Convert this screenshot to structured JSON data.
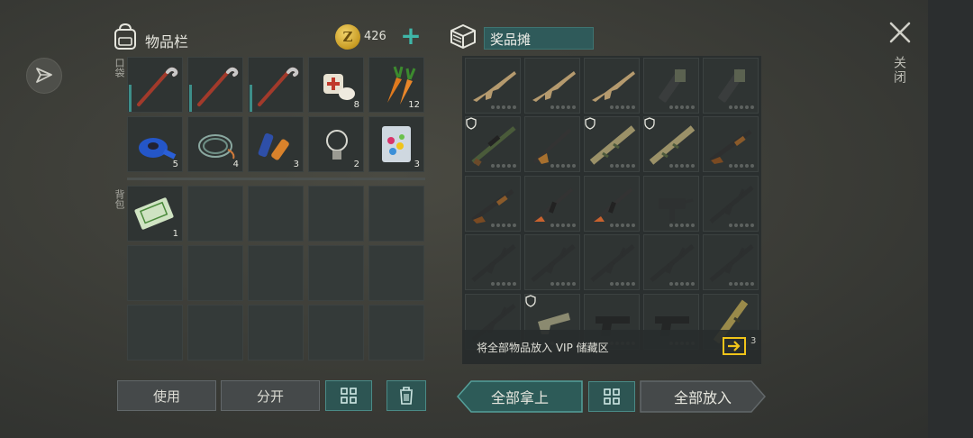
{
  "header": {
    "inventory_title": "物品栏",
    "coin_symbol": "Z",
    "coin_count": "426",
    "plus_label": "+",
    "stash_title": "奖品摊",
    "close_label": "关闭"
  },
  "sections": {
    "pocket_label": "口袋",
    "backpack_label": "背包"
  },
  "pockets": [
    {
      "item": "crowbar",
      "count": ""
    },
    {
      "item": "crowbar",
      "count": ""
    },
    {
      "item": "crowbar",
      "count": ""
    },
    {
      "item": "bandage",
      "count": "8"
    },
    {
      "item": "carrot",
      "count": "12"
    },
    {
      "item": "tape",
      "count": "5"
    },
    {
      "item": "wire",
      "count": "4"
    },
    {
      "item": "battery",
      "count": "3"
    },
    {
      "item": "light-bulb",
      "count": "2"
    },
    {
      "item": "candy-bag",
      "count": "3"
    }
  ],
  "backpack": [
    {
      "item": "banknote",
      "count": "1"
    }
  ],
  "stash": [
    "scar-rifle",
    "scar-rifle",
    "scar-rifle",
    "minigun",
    "minigun",
    "sniper-rifle",
    "vss-rifle",
    "camo-rifle",
    "camo-rifle",
    "shotgun",
    "shotgun",
    "ak47",
    "ak47",
    "uzi",
    "m16",
    "m16",
    "m16",
    "m16",
    "m16",
    "m16",
    "m16",
    "camo-pistol",
    "pistol",
    "pistol",
    "grenade-launcher"
  ],
  "stash_shields": [
    5,
    7,
    8,
    21
  ],
  "vip": {
    "text": "将全部物品放入 VIP 储藏区",
    "count": "3"
  },
  "buttons": {
    "use": "使用",
    "split": "分开",
    "take_all": "全部拿上",
    "put_all": "全部放入"
  },
  "colors": {
    "accent": "#3fb6a8",
    "teal_dark": "#2d5553",
    "slot_bg": "#2f3433",
    "coin": "#d9ad37",
    "vip_arrow": "#f0c419"
  }
}
